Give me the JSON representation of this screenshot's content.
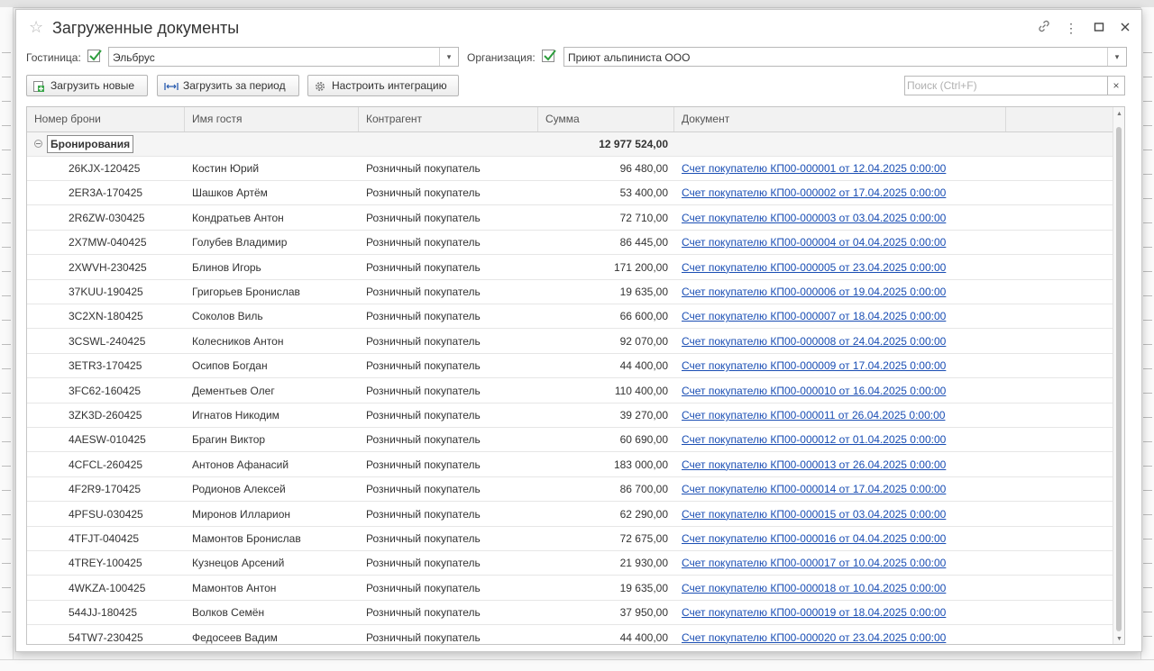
{
  "window": {
    "title": "Загруженные документы",
    "link_icon": "link-icon",
    "more_icon": "more-vertical-icon",
    "maximize_icon": "maximize-icon",
    "close_icon": "close-icon"
  },
  "filters": {
    "hotel_label": "Гостиница:",
    "hotel_checked": true,
    "hotel_value": "Эльбрус",
    "org_label": "Организация:",
    "org_checked": true,
    "org_value": "Приют альпиниста ООО"
  },
  "toolbar": {
    "load_new": "Загрузить новые",
    "load_period": "Загрузить за период",
    "configure": "Настроить интеграцию",
    "search_placeholder": "Поиск (Ctrl+F)",
    "clear_symbol": "×"
  },
  "table": {
    "columns": [
      "Номер брони",
      "Имя гостя",
      "Контрагент",
      "Сумма",
      "Документ"
    ],
    "group": {
      "label": "Бронирования",
      "total": "12 977 524,00"
    },
    "rows": [
      {
        "booking": "26KJX-120425",
        "guest": "Костин Юрий",
        "contractor": "Розничный покупатель",
        "amount": "96 480,00",
        "document": "Счет покупателю КП00-000001 от 12.04.2025 0:00:00"
      },
      {
        "booking": "2ER3A-170425",
        "guest": "Шашков Артём",
        "contractor": "Розничный покупатель",
        "amount": "53 400,00",
        "document": "Счет покупателю КП00-000002 от 17.04.2025 0:00:00"
      },
      {
        "booking": "2R6ZW-030425",
        "guest": "Кондратьев Антон",
        "contractor": "Розничный покупатель",
        "amount": "72 710,00",
        "document": "Счет покупателю КП00-000003 от 03.04.2025 0:00:00"
      },
      {
        "booking": "2X7MW-040425",
        "guest": "Голубев Владимир",
        "contractor": "Розничный покупатель",
        "amount": "86 445,00",
        "document": "Счет покупателю КП00-000004 от 04.04.2025 0:00:00"
      },
      {
        "booking": "2XWVH-230425",
        "guest": "Блинов Игорь",
        "contractor": "Розничный покупатель",
        "amount": "171 200,00",
        "document": "Счет покупателю КП00-000005 от 23.04.2025 0:00:00"
      },
      {
        "booking": "37KUU-190425",
        "guest": "Григорьев Бронислав",
        "contractor": "Розничный покупатель",
        "amount": "19 635,00",
        "document": "Счет покупателю КП00-000006 от 19.04.2025 0:00:00"
      },
      {
        "booking": "3C2XN-180425",
        "guest": "Соколов Виль",
        "contractor": "Розничный покупатель",
        "amount": "66 600,00",
        "document": "Счет покупателю КП00-000007 от 18.04.2025 0:00:00"
      },
      {
        "booking": "3CSWL-240425",
        "guest": "Колесников Антон",
        "contractor": "Розничный покупатель",
        "amount": "92 070,00",
        "document": "Счет покупателю КП00-000008 от 24.04.2025 0:00:00"
      },
      {
        "booking": "3ETR3-170425",
        "guest": "Осипов Богдан",
        "contractor": "Розничный покупатель",
        "amount": "44 400,00",
        "document": "Счет покупателю КП00-000009 от 17.04.2025 0:00:00"
      },
      {
        "booking": "3FC62-160425",
        "guest": "Дементьев Олег",
        "contractor": "Розничный покупатель",
        "amount": "110 400,00",
        "document": "Счет покупателю КП00-000010 от 16.04.2025 0:00:00"
      },
      {
        "booking": "3ZK3D-260425",
        "guest": "Игнатов Никодим",
        "contractor": "Розничный покупатель",
        "amount": "39 270,00",
        "document": "Счет покупателю КП00-000011 от 26.04.2025 0:00:00"
      },
      {
        "booking": "4AESW-010425",
        "guest": "Брагин Виктор",
        "contractor": "Розничный покупатель",
        "amount": "60 690,00",
        "document": "Счет покупателю КП00-000012 от 01.04.2025 0:00:00"
      },
      {
        "booking": "4CFCL-260425",
        "guest": "Антонов Афанасий",
        "contractor": "Розничный покупатель",
        "amount": "183 000,00",
        "document": "Счет покупателю КП00-000013 от 26.04.2025 0:00:00"
      },
      {
        "booking": "4F2R9-170425",
        "guest": "Родионов Алексей",
        "contractor": "Розничный покупатель",
        "amount": "86 700,00",
        "document": "Счет покупателю КП00-000014 от 17.04.2025 0:00:00"
      },
      {
        "booking": "4PFSU-030425",
        "guest": "Миронов Илларион",
        "contractor": "Розничный покупатель",
        "amount": "62 290,00",
        "document": "Счет покупателю КП00-000015 от 03.04.2025 0:00:00"
      },
      {
        "booking": "4TFJT-040425",
        "guest": "Мамонтов Бронислав",
        "contractor": "Розничный покупатель",
        "amount": "72 675,00",
        "document": "Счет покупателю КП00-000016 от 04.04.2025 0:00:00"
      },
      {
        "booking": "4TREY-100425",
        "guest": "Кузнецов Арсений",
        "contractor": "Розничный покупатель",
        "amount": "21 930,00",
        "document": "Счет покупателю КП00-000017 от 10.04.2025 0:00:00"
      },
      {
        "booking": "4WKZA-100425",
        "guest": "Мамонтов Антон",
        "contractor": "Розничный покупатель",
        "amount": "19 635,00",
        "document": "Счет покупателю КП00-000018 от 10.04.2025 0:00:00"
      },
      {
        "booking": "544JJ-180425",
        "guest": "Волков Семён",
        "contractor": "Розничный покупатель",
        "amount": "37 950,00",
        "document": "Счет покупателю КП00-000019 от 18.04.2025 0:00:00"
      },
      {
        "booking": "54TW7-230425",
        "guest": "Федосеев Вадим",
        "contractor": "Розничный покупатель",
        "amount": "44 400,00",
        "document": "Счет покупателю КП00-000020 от 23.04.2025 0:00:00"
      }
    ]
  },
  "colors": {
    "link": "#1a4eb4",
    "check": "#2e9e3e",
    "header_bg": "#f2f2f2"
  }
}
